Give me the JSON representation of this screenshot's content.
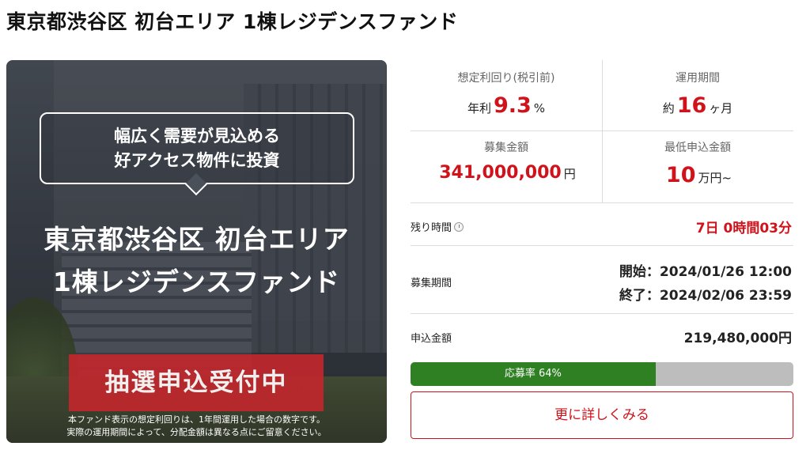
{
  "title": "東京都渋谷区 初台エリア 1棟レジデンスファンド",
  "hero": {
    "bubble_line1": "幅広く需要が見込める",
    "bubble_line2": "好アクセス物件に投資",
    "heading_line1": "東京都渋谷区 初台エリア",
    "heading_line2": "1棟レジデンスファンド",
    "badge": "抽選申込受付中",
    "note_line1": "本ファンド表示の想定利回りは、1年間運用した場合の数字です。",
    "note_line2": "実際の運用期間によって、分配金額は異なる点にご留意ください。"
  },
  "stats": {
    "yield": {
      "label": "想定利回り(税引前)",
      "prefix": "年利",
      "value": "9.3",
      "suffix": "%"
    },
    "period": {
      "label": "運用期間",
      "prefix": "約",
      "value": "16",
      "suffix": "ヶ月"
    },
    "raise": {
      "label": "募集金額",
      "value": "341,000,000",
      "suffix": "円"
    },
    "minimum": {
      "label": "最低申込金額",
      "value": "10",
      "suffix": "万円~"
    }
  },
  "remaining": {
    "label": "残り時間",
    "icon": "clock-icon",
    "value": "7日 0時間03分"
  },
  "recruitment": {
    "label": "募集期間",
    "start": "開始：2024/01/26 12:00",
    "end": "終了：2024/02/06 23:59"
  },
  "applied": {
    "label": "申込金額",
    "value": "219,480,000円"
  },
  "progress": {
    "label": "応募率 64%",
    "percent": 64,
    "color": "#2e8022",
    "track_color": "#bdbdbd"
  },
  "detail_button": "更に詳しくみる",
  "colors": {
    "accent": "#d0121b",
    "badge": "#c0272d"
  }
}
